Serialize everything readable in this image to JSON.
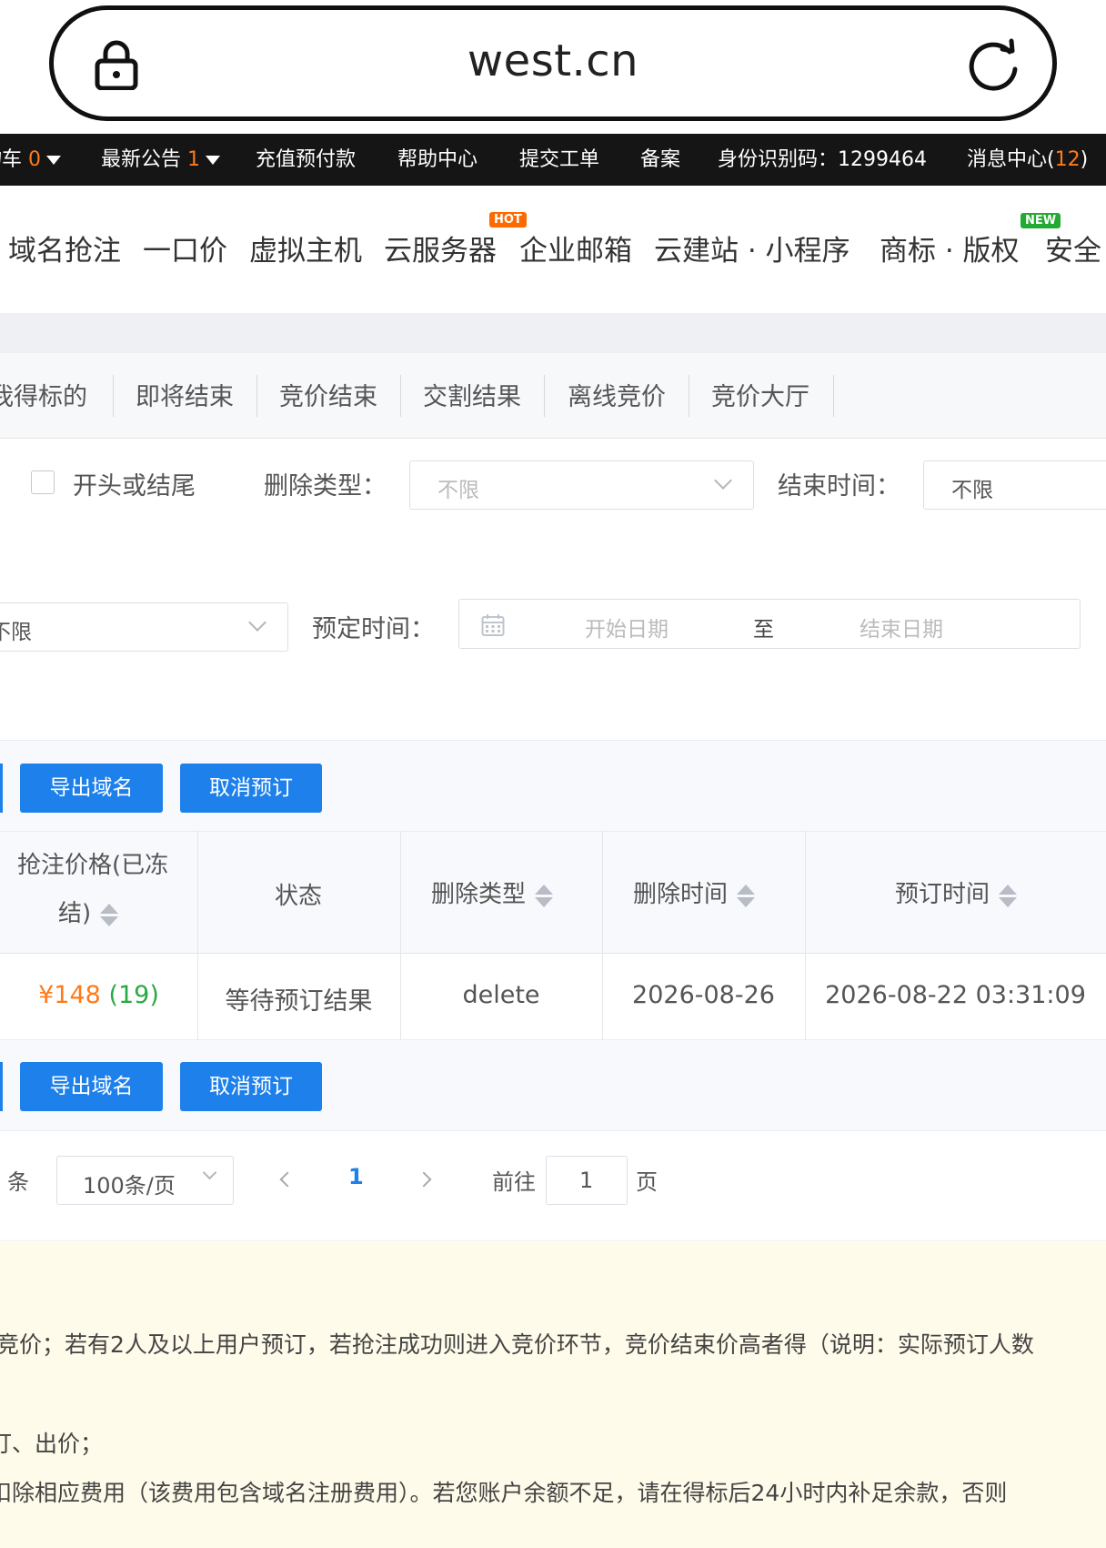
{
  "browser": {
    "url": "west.cn"
  },
  "topbar": {
    "cart_label": "购物车",
    "cart_count": "0",
    "announce_label": "最新公告",
    "announce_count": "1",
    "recharge": "充值预付款",
    "help": "帮助中心",
    "ticket": "提交工单",
    "beian": "备案",
    "id_code_label": "身份识别码：",
    "id_code_value": "1299464",
    "msg_prefix": "消息中心(",
    "msg_count": "12",
    "msg_suffix": ")"
  },
  "mainnav": {
    "items": [
      "域名抢注",
      "一口价",
      "虚拟主机",
      "云服务器",
      "企业邮箱",
      "云建站 · 小程序",
      "商标 · 版权",
      "安全"
    ],
    "hot_badge": "HOT",
    "new_badge": "NEW"
  },
  "tabs": [
    "我得标的",
    "即将结束",
    "竞价结束",
    "交割结果",
    "离线竞价",
    "竞价大厅"
  ],
  "filters": {
    "checkbox_label": "开头或结尾",
    "delete_type_label": "删除类型：",
    "delete_type_value": "不限",
    "end_time_label": "结束时间：",
    "end_time_value": "不限",
    "left_select_value": "不限",
    "booking_time_label": "预定时间：",
    "date_start_placeholder": "开始日期",
    "date_to": "至",
    "date_end_placeholder": "结束日期"
  },
  "toolbar": {
    "export": "导出域名",
    "cancel": "取消预订"
  },
  "table": {
    "headers": {
      "price_line1": "抢注价格(已冻",
      "price_line2": "结)",
      "status": "状态",
      "delete_type": "删除类型",
      "delete_time": "删除时间",
      "booking_time": "预订时间"
    },
    "rows": [
      {
        "price": "¥148",
        "count": "(19)",
        "status": "等待预订结果",
        "delete_type": "delete",
        "delete_time": "2026-08-26",
        "booking_time": "2026-08-22 03:31:09"
      }
    ]
  },
  "pagination": {
    "total_suffix": "条",
    "page_size": "100条/页",
    "current_page": "1",
    "goto_label": "前往",
    "goto_value": "1",
    "page_suffix": "页"
  },
  "notice": {
    "line1": "竞价；若有2人及以上用户预订，若抢注成功则进入竞价环节，竞价结束价高者得（说明：实际预订人数",
    "line2": "订、出价；",
    "line3": "扣除相应费用（该费用包含域名注册费用）。若您账户余额不足，请在得标后24小时内补足余款，否则"
  },
  "colors": {
    "accent": "#1e80ea",
    "orange": "#ff7a1a",
    "green": "#2aa844",
    "notice_bg": "#fffbea"
  }
}
